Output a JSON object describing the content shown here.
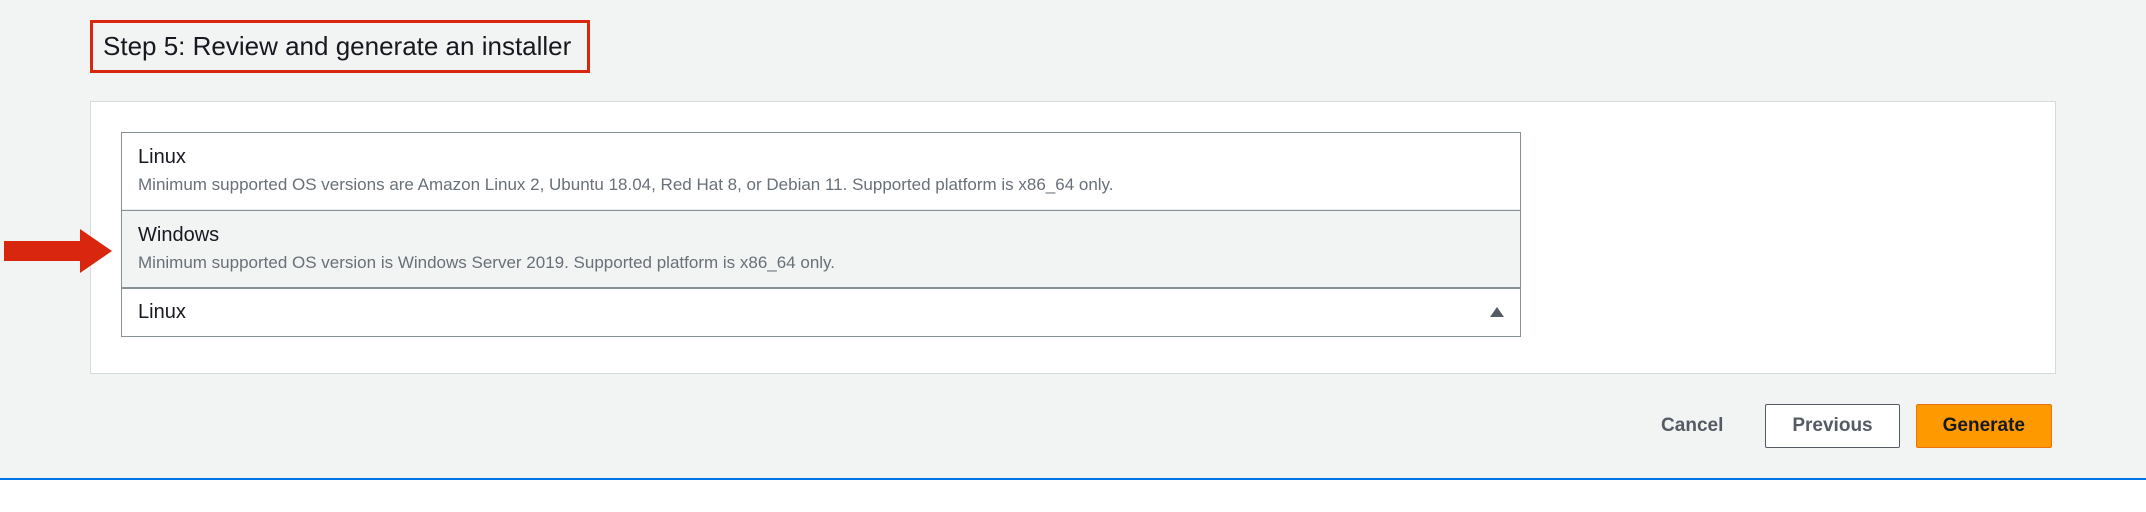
{
  "step": {
    "title": "Step 5: Review and generate an installer"
  },
  "dropdown": {
    "options": [
      {
        "title": "Linux",
        "desc": "Minimum supported OS versions are Amazon Linux 2, Ubuntu 18.04, Red Hat 8, or Debian 11. Supported platform is x86_64 only."
      },
      {
        "title": "Windows",
        "desc": "Minimum supported OS version is Windows Server 2019. Supported platform is x86_64 only."
      }
    ],
    "selected": "Linux"
  },
  "buttons": {
    "cancel": "Cancel",
    "previous": "Previous",
    "generate": "Generate"
  }
}
